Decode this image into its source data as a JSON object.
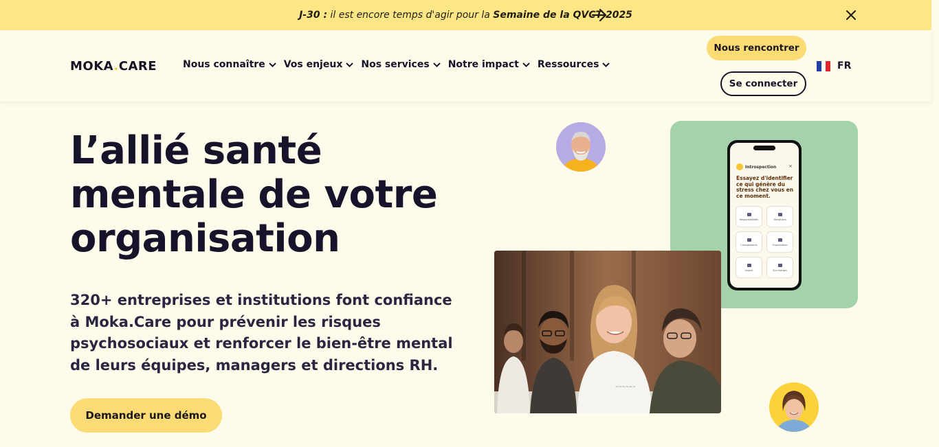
{
  "announcement": {
    "prefix": "J-30 :",
    "text": " il est encore temps d'agir pour la ",
    "highlight": "Semaine de la QVCT 2025",
    "arrow_icon": "arrow-right-icon",
    "close_icon": "close-icon"
  },
  "header": {
    "logo_left": "MOKA",
    "logo_dot": ".",
    "logo_right": "CARE",
    "nav": [
      {
        "label": "Nous connaître"
      },
      {
        "label": "Vos enjeux"
      },
      {
        "label": "Nos services"
      },
      {
        "label": "Notre impact"
      },
      {
        "label": "Ressources"
      }
    ],
    "meet_button": "Nous rencontrer",
    "login_button": "Se connecter",
    "language": "FR"
  },
  "hero": {
    "title_line1": "L’allié santé",
    "title_line2": "mentale de votre",
    "title_line3": "organisation",
    "subtitle": "320+ entreprises et institutions font confiance à Moka.Care pour prévenir les risques psychosociaux et renforcer le bien-être mental de leurs équipes, managers et directions RH.",
    "cta": "Demander une démo"
  },
  "phone": {
    "header": "Introspection",
    "close": "×",
    "question": "Essayez d'identifier ce qui génère du stress chez vous en ce moment.",
    "tiles": [
      "Responsabilités",
      "Transitions",
      "Changements",
      "Organisation",
      "Argent",
      "Sur-charges"
    ]
  },
  "colors": {
    "background": "#fefbea",
    "announcement": "#fde685",
    "accent": "#fbdb73",
    "text": "#16132b",
    "green_card": "#a3d2ad"
  }
}
